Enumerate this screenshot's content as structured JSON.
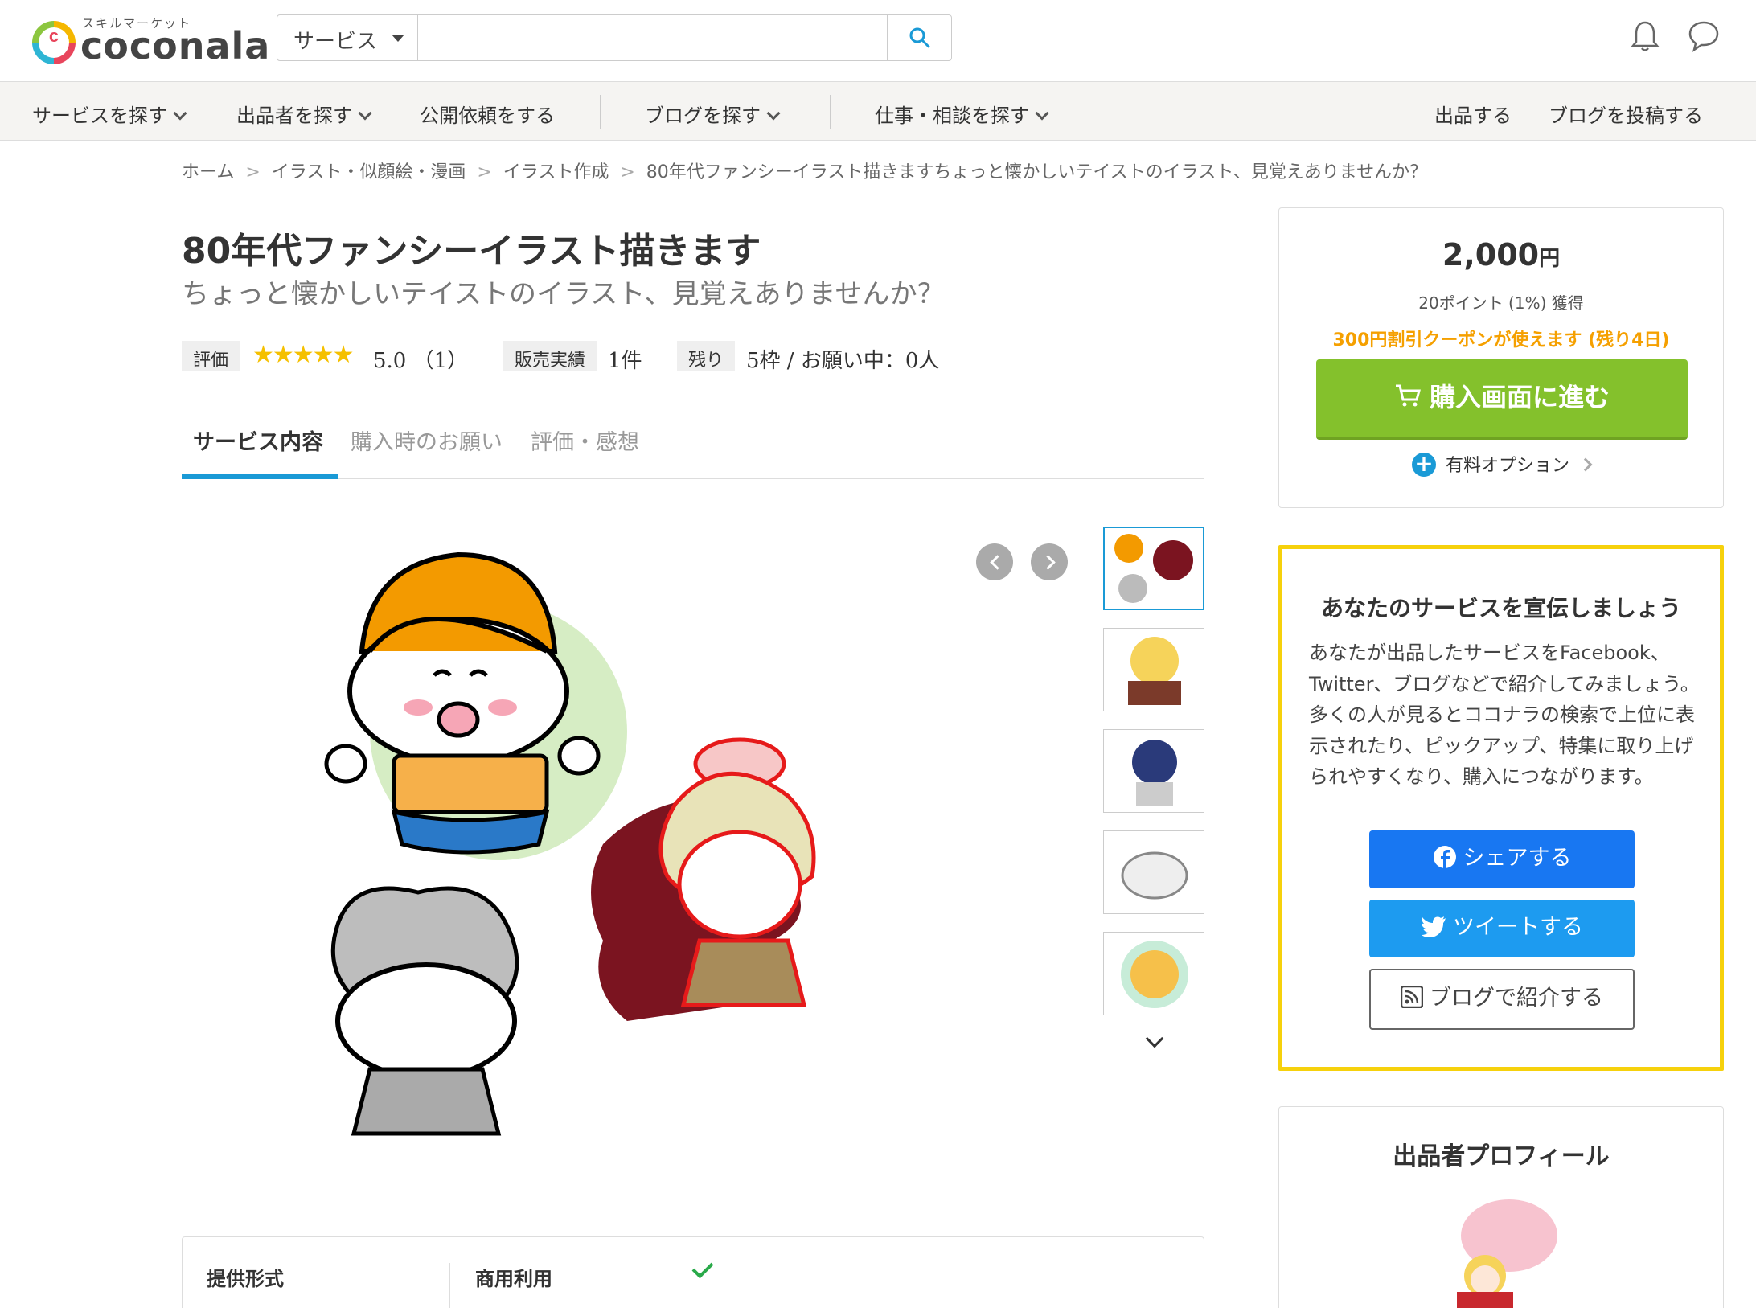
{
  "header": {
    "logo_sub": "スキルマーケット",
    "logo_text": "coconala",
    "search_category": "サービス",
    "search_placeholder": ""
  },
  "nav": {
    "items": [
      "サービスを探す",
      "出品者を探す",
      "公開依頼をする",
      "ブログを探す",
      "仕事・相談を探す"
    ],
    "right_items": [
      "出品する",
      "ブログを投稿する"
    ]
  },
  "breadcrumb": [
    "ホーム",
    "イラスト・似顔絵・漫画",
    "イラスト作成",
    "80年代ファンシーイラスト描きますちょっと懐かしいテイストのイラスト、見覚えありませんか？"
  ],
  "service": {
    "title": "80年代ファンシーイラスト描きます",
    "subtitle": "ちょっと懐かしいテイストのイラスト、見覚えありませんか？",
    "rating_label": "評価",
    "stars": "★★★★★",
    "rating": "5.0 （1）",
    "sales_label": "販売実績",
    "sales": "1件",
    "remaining_label": "残り",
    "remaining": "5枠 / お願い中：0人"
  },
  "tabs": [
    "サービス内容",
    "購入時のお願い",
    "評価・感想"
  ],
  "info": {
    "format_label": "提供形式",
    "commercial_label": "商用利用"
  },
  "purchase": {
    "price": "2,000",
    "yen": "円",
    "points": "20ポイント (1%) 獲得",
    "coupon": "300円割引クーポンが使えます (残り4日)",
    "buy_label": "購入画面に進む",
    "option_label": "有料オプション"
  },
  "promote": {
    "title": "あなたのサービスを宣伝しましょう",
    "body": "あなたが出品したサービスをFacebook、Twitter、ブログなどで紹介してみましょう。多くの人が見るとココナラの検索で上位に表示されたり、ピックアップ、特集に取り上げられやすくなり、購入につながります。",
    "facebook_label": "シェアする",
    "twitter_label": "ツイートする",
    "blog_label": "ブログで紹介する"
  },
  "profile": {
    "title": "出品者プロフィール"
  },
  "colors": {
    "accent_blue": "#1a9ad6",
    "buy_green": "#84c12c",
    "coupon_orange": "#f5a000",
    "promote_yellow": "#f6d10c",
    "facebook": "#1877f2",
    "twitter": "#1d9bf0"
  },
  "icons": [
    "search-icon",
    "bell-icon",
    "chat-icon",
    "cart-icon",
    "facebook-icon",
    "twitter-icon",
    "rss-icon",
    "check-icon"
  ]
}
